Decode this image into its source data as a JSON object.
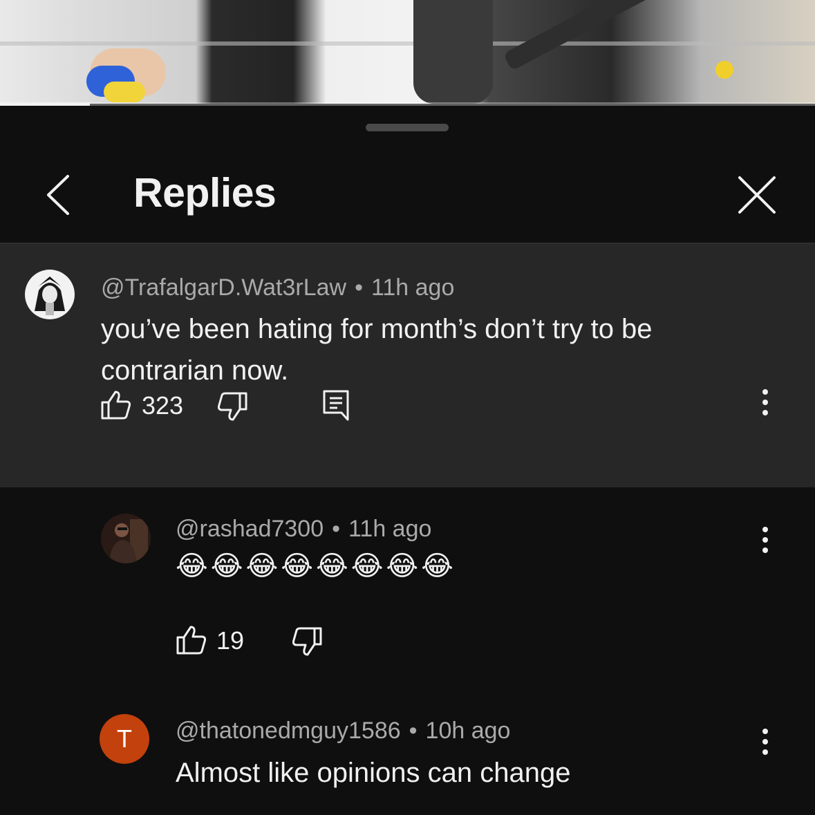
{
  "video": {
    "progress_fraction": 0.11
  },
  "sheet": {
    "title": "Replies"
  },
  "parent_comment": {
    "handle": "@TrafalgarD.Wat3rLaw",
    "time": "11h ago",
    "text": "you’ve been hating for month’s don’t try to be contrarian now.",
    "likes": "323"
  },
  "replies": [
    {
      "handle": "@rashad7300",
      "time": "11h ago",
      "text": "😂😂😂😂😂😂😂😂",
      "likes": "19"
    },
    {
      "handle": "@thatonedmguy1586",
      "time": "10h ago",
      "text": "Almost like opinions can change",
      "avatar_letter": "T",
      "avatar_color": "#c2410c"
    }
  ],
  "separator": "•",
  "icons": [
    "chevron-left-icon",
    "close-icon",
    "more-vert-icon",
    "thumb-up-icon",
    "thumb-down-icon",
    "reply-comment-icon"
  ]
}
